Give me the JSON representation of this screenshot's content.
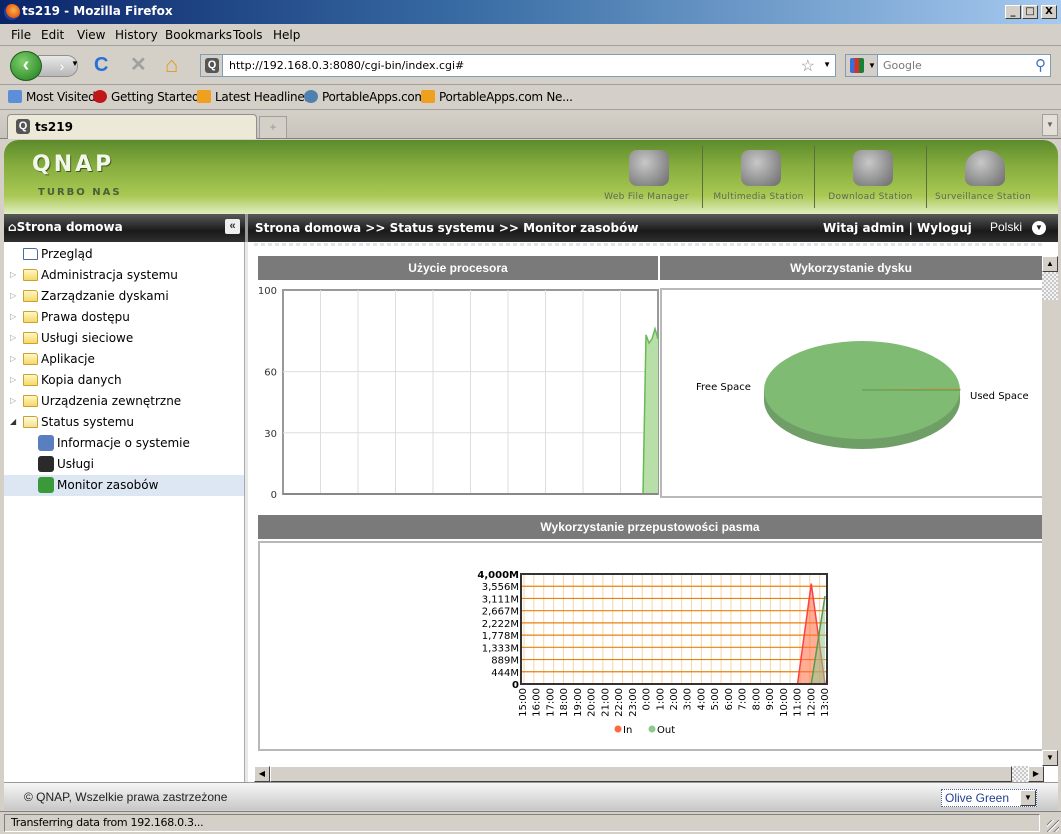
{
  "window": {
    "title": "ts219 - Mozilla Firefox",
    "controls": {
      "minimize": "_",
      "maximize": "□",
      "close": "X"
    }
  },
  "menu": [
    "File",
    "Edit",
    "View",
    "History",
    "Bookmarks",
    "Tools",
    "Help"
  ],
  "nav": {
    "url": "http://192.168.0.3:8080/cgi-bin/index.cgi#",
    "search_placeholder": "Google",
    "icons": {
      "back": "‹",
      "forward": "›",
      "reload": "C",
      "stop": "✕",
      "home": "⌂",
      "bookmark": "☆",
      "search": "⚲"
    }
  },
  "bookmarks": [
    {
      "label": "Most Visited",
      "icon": "most-visited-icon",
      "color": "#5d8fd9"
    },
    {
      "label": "Getting Started",
      "icon": "getting-started-icon",
      "color": "#c0181a"
    },
    {
      "label": "Latest Headlines",
      "icon": "rss-icon",
      "color": "#f0a020"
    },
    {
      "label": "PortableApps.com",
      "icon": "portableapps-icon",
      "color": "#5080b0"
    },
    {
      "label": "PortableApps.com Ne...",
      "icon": "rss-icon",
      "color": "#f0a020"
    }
  ],
  "tabs": [
    {
      "label": "ts219",
      "active": true
    }
  ],
  "new_tab": "+",
  "app": {
    "logo": "QNAP",
    "sublogo": "TURBO NAS",
    "stations": [
      {
        "label": "Web File Manager",
        "icon": "web-file-manager-icon"
      },
      {
        "label": "Multimedia Station",
        "icon": "multimedia-station-icon"
      },
      {
        "label": "Download Station",
        "icon": "download-station-icon"
      },
      {
        "label": "Surveillance Station",
        "icon": "surveillance-station-icon"
      }
    ],
    "sidebar_title": "Strona domowa",
    "collapse": "«",
    "breadcrumb": "Strona domowa >> Status systemu >> Monitor zasobów",
    "welcome": "Witaj admin | Wyloguj",
    "language": "Polski",
    "tree": [
      {
        "label": "Przegląd",
        "type": "page"
      },
      {
        "label": "Administracja systemu",
        "type": "folder"
      },
      {
        "label": "Zarządzanie dyskami",
        "type": "folder"
      },
      {
        "label": "Prawa dostępu",
        "type": "folder"
      },
      {
        "label": "Usługi sieciowe",
        "type": "folder"
      },
      {
        "label": "Aplikacje",
        "type": "folder"
      },
      {
        "label": "Kopia danych",
        "type": "folder"
      },
      {
        "label": "Urządzenia zewnętrzne",
        "type": "folder"
      },
      {
        "label": "Status systemu",
        "type": "folder-open"
      },
      {
        "label": "Informacje o systemie",
        "type": "child"
      },
      {
        "label": "Usługi",
        "type": "child"
      },
      {
        "label": "Monitor zasobów",
        "type": "child",
        "selected": true
      }
    ],
    "footer_copyright": "© QNAP, Wszelkie prawa zastrzeżone",
    "theme_selected": "Olive Green"
  },
  "status_text": "Transferring data from 192.168.0.3...",
  "chart_data": [
    {
      "type": "area",
      "title": "Użycie procesora",
      "ylabel": "",
      "xlabel": "",
      "yticks": [
        0,
        30,
        60,
        100
      ],
      "ylim": [
        0,
        100
      ],
      "grid": true,
      "x": [
        0,
        1,
        2,
        3,
        4,
        5,
        6,
        7,
        8,
        9,
        10,
        11,
        12,
        13,
        14,
        15,
        16,
        17,
        18,
        19,
        20
      ],
      "values": [
        0,
        0,
        0,
        0,
        0,
        0,
        0,
        0,
        0,
        0,
        0,
        0,
        0,
        0,
        0,
        0,
        0,
        0,
        0,
        0,
        0
      ],
      "tail": [
        0,
        0,
        78,
        74,
        76,
        81,
        76
      ],
      "color": "#66bb55"
    },
    {
      "type": "pie",
      "title": "Wykorzystanie dysku",
      "labels": [
        "Free Space",
        "Used Space"
      ],
      "values": [
        99.7,
        0.3
      ],
      "colors": [
        "#7fbb72",
        "#e08a3a"
      ]
    },
    {
      "type": "area",
      "title": "Wykorzystanie przepustowości pasma",
      "categories": [
        "15:00",
        "16:00",
        "17:00",
        "18:00",
        "19:00",
        "20:00",
        "21:00",
        "22:00",
        "23:00",
        "0:00",
        "1:00",
        "2:00",
        "3:00",
        "4:00",
        "5:00",
        "6:00",
        "7:00",
        "8:00",
        "9:00",
        "10:00",
        "11:00",
        "12:00",
        "13:00"
      ],
      "yticks": [
        "0",
        "444M",
        "889M",
        "1,333M",
        "1,778M",
        "2,222M",
        "2,667M",
        "3,111M",
        "3,556M",
        "4,000M"
      ],
      "ylim": [
        0,
        4000
      ],
      "series": [
        {
          "name": "In",
          "values": [
            0,
            0,
            0,
            0,
            0,
            0,
            0,
            0,
            0,
            0,
            0,
            0,
            0,
            0,
            0,
            0,
            0,
            0,
            0,
            0,
            0,
            3650,
            0
          ],
          "color": "#ff6a3d"
        },
        {
          "name": "Out",
          "values": [
            0,
            0,
            0,
            0,
            0,
            0,
            0,
            0,
            0,
            0,
            0,
            0,
            0,
            0,
            0,
            0,
            0,
            0,
            0,
            0,
            0,
            0,
            3200
          ],
          "color": "#8fc98f"
        }
      ],
      "legend": "bottom"
    }
  ]
}
